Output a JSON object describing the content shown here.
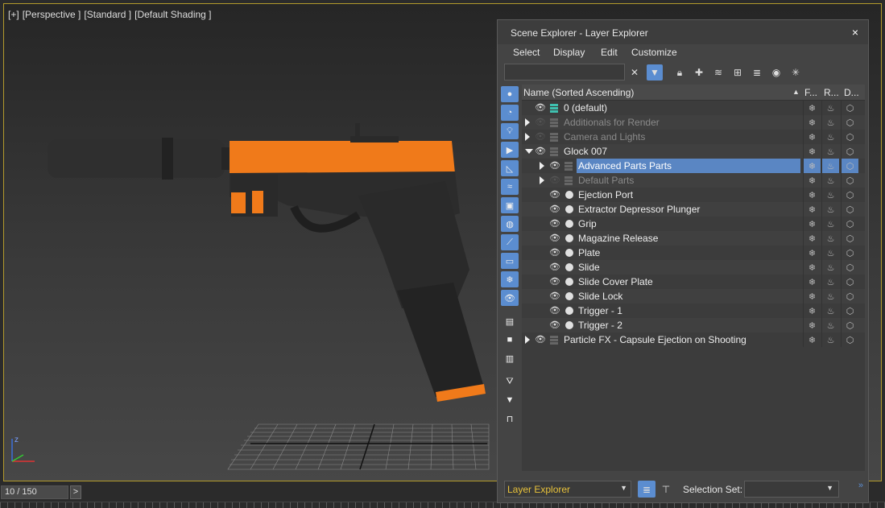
{
  "viewport": {
    "labels": [
      "[+]",
      "[Perspective ]",
      "[Standard ]",
      "[Default Shading ]"
    ],
    "gizmo_z": "z"
  },
  "timebar": {
    "frame": "10 / 150",
    "next": ">"
  },
  "explorer": {
    "title": "Scene Explorer - Layer Explorer",
    "close": "×",
    "menu": [
      "Select",
      "Display",
      "Edit",
      "Customize"
    ],
    "search": {
      "value": "",
      "placeholder": ""
    },
    "columns": {
      "name": "Name (Sorted Ascending)",
      "sort_arrow": "▲",
      "f": "F...",
      "r": "R...",
      "d": "D..."
    },
    "rows": [
      {
        "label": "0 (default)",
        "kind": "layer",
        "level": 0,
        "expander": "none",
        "visible": true,
        "dim": false,
        "selected": false
      },
      {
        "label": "Additionals for Render",
        "kind": "layer",
        "level": 0,
        "expander": "closed",
        "visible": false,
        "dim": true,
        "selected": false
      },
      {
        "label": "Camera and Lights",
        "kind": "layer",
        "level": 0,
        "expander": "closed",
        "visible": false,
        "dim": true,
        "selected": false
      },
      {
        "label": "Glock 007",
        "kind": "layer",
        "level": 0,
        "expander": "open",
        "visible": true,
        "dim": false,
        "selected": false
      },
      {
        "label": "Advanced Parts Parts",
        "kind": "layer",
        "level": 1,
        "expander": "closed",
        "visible": true,
        "dim": false,
        "selected": true
      },
      {
        "label": "Default Parts",
        "kind": "layer",
        "level": 1,
        "expander": "closed",
        "visible": false,
        "dim": true,
        "selected": false
      },
      {
        "label": "Ejection Port",
        "kind": "object",
        "level": 1,
        "expander": "none",
        "visible": true,
        "dim": false,
        "selected": false
      },
      {
        "label": "Extractor Depressor Plunger",
        "kind": "object",
        "level": 1,
        "expander": "none",
        "visible": true,
        "dim": false,
        "selected": false
      },
      {
        "label": "Grip",
        "kind": "object",
        "level": 1,
        "expander": "none",
        "visible": true,
        "dim": false,
        "selected": false
      },
      {
        "label": "Magazine Release",
        "kind": "object",
        "level": 1,
        "expander": "none",
        "visible": true,
        "dim": false,
        "selected": false
      },
      {
        "label": "Plate",
        "kind": "object",
        "level": 1,
        "expander": "none",
        "visible": true,
        "dim": false,
        "selected": false
      },
      {
        "label": "Slide",
        "kind": "object",
        "level": 1,
        "expander": "none",
        "visible": true,
        "dim": false,
        "selected": false
      },
      {
        "label": "Slide Cover Plate",
        "kind": "object",
        "level": 1,
        "expander": "none",
        "visible": true,
        "dim": false,
        "selected": false
      },
      {
        "label": "Slide Lock",
        "kind": "object",
        "level": 1,
        "expander": "none",
        "visible": true,
        "dim": false,
        "selected": false
      },
      {
        "label": "Trigger - 1",
        "kind": "object",
        "level": 1,
        "expander": "none",
        "visible": true,
        "dim": false,
        "selected": false
      },
      {
        "label": "Trigger - 2",
        "kind": "object",
        "level": 1,
        "expander": "none",
        "visible": true,
        "dim": false,
        "selected": false
      },
      {
        "label": "Particle FX - Capsule Ejection on Shooting",
        "kind": "layer",
        "level": 0,
        "expander": "closed",
        "visible": true,
        "dim": false,
        "selected": false
      }
    ],
    "footer": {
      "explorer_name": "Layer Explorer",
      "selection_set_label": "Selection Set:",
      "selection_set_value": "",
      "more": "»"
    }
  },
  "colors": {
    "accent": "#5b8dd0",
    "viewport_border": "#b39a2c",
    "gun_orange": "#f07a1a",
    "footer_text": "#e8c23a"
  }
}
